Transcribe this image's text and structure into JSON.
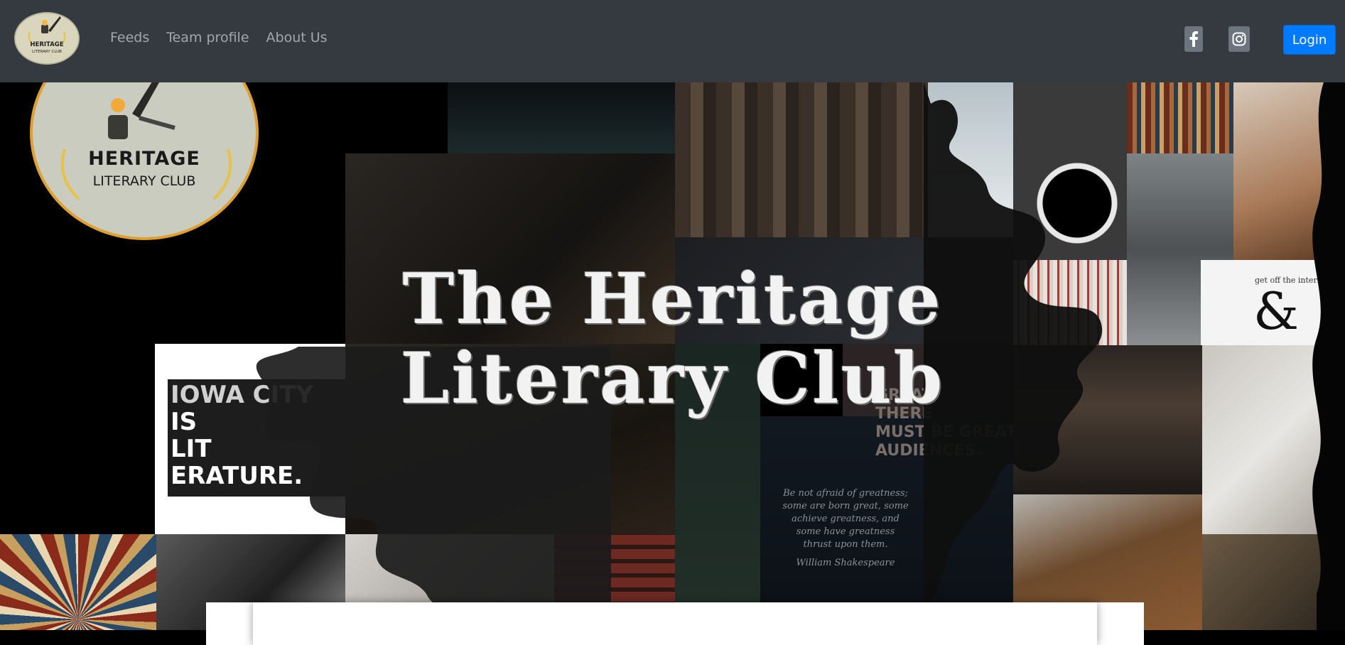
{
  "navbar": {
    "logo_line1": "HERITAGE",
    "logo_line2": "LITERARY CLUB",
    "links": [
      "Feeds",
      "Team profile",
      "About Us"
    ],
    "social": {
      "facebook_icon": "facebook-icon",
      "instagram_icon": "instagram-icon"
    },
    "login_label": "Login",
    "colors": {
      "background": "#343a40",
      "link": "rgba(255,255,255,0.55)",
      "login": "#007bff"
    }
  },
  "hero": {
    "title_line1": "The Heritage",
    "title_line2": "Literary Club",
    "logo_line1": "HERITAGE",
    "logo_line2": "LITERARY CLUB",
    "poster_lines": [
      "IOWA CITY",
      "IS",
      "LIT",
      "ERATURE."
    ],
    "quote_right": [
      "GREAT",
      "THERE",
      "MUST BE GREAT",
      "AUDIENCES."
    ],
    "shakespeare_quote": "Be not afraid of greatness; some are born great, some achieve greatness, and some have greatness thrust upon them.",
    "shakespeare_author": "William Shakespeare",
    "ampersand_caption": "get off the internet"
  }
}
